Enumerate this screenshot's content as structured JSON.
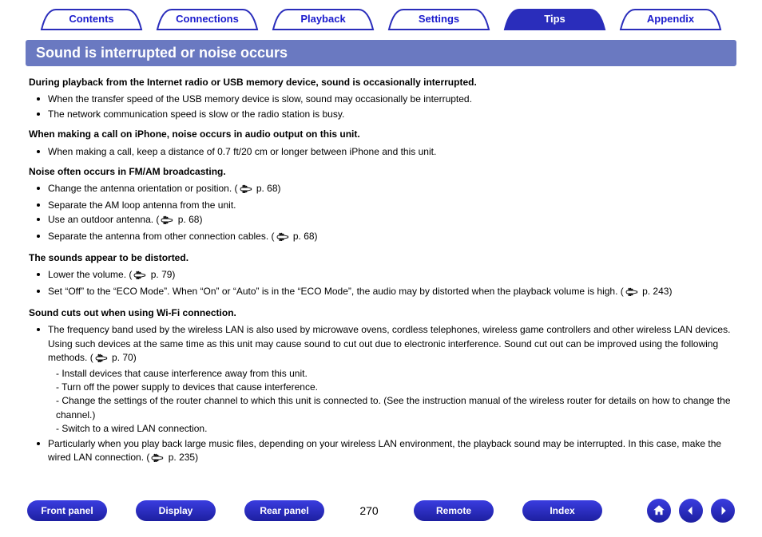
{
  "tabs": [
    {
      "label": "Contents",
      "active": false
    },
    {
      "label": "Connections",
      "active": false
    },
    {
      "label": "Playback",
      "active": false
    },
    {
      "label": "Settings",
      "active": false
    },
    {
      "label": "Tips",
      "active": true
    },
    {
      "label": "Appendix",
      "active": false
    }
  ],
  "title": "Sound is interrupted or noise occurs",
  "sections": [
    {
      "heading": "During playback from the Internet radio or USB memory device, sound is occasionally interrupted.",
      "items": [
        {
          "text": "When the transfer speed of the USB memory device is slow, sound may occasionally be interrupted."
        },
        {
          "text": "The network communication speed is slow or the radio station is busy."
        }
      ]
    },
    {
      "heading": "When making a call on iPhone, noise occurs in audio output on this unit.",
      "items": [
        {
          "text": "When making a call, keep a distance of 0.7 ft/20 cm or longer between iPhone and this unit."
        }
      ]
    },
    {
      "heading": "Noise often occurs in FM/AM broadcasting.",
      "items": [
        {
          "text": "Change the antenna orientation or position.  (",
          "ref": " p. 68)",
          "hasRef": true
        },
        {
          "text": "Separate the AM loop antenna from the unit."
        },
        {
          "text": "Use an outdoor antenna.  (",
          "ref": " p. 68)",
          "hasRef": true
        },
        {
          "text": "Separate the antenna from other connection cables.  (",
          "ref": " p. 68)",
          "hasRef": true
        }
      ]
    },
    {
      "heading": "The sounds appear to be distorted.",
      "items": [
        {
          "text": "Lower the volume.  (",
          "ref": " p. 79)",
          "hasRef": true
        },
        {
          "text": "Set “Off” to the “ECO Mode”. When “On” or “Auto” is in the “ECO Mode”, the audio may by distorted when the playback volume is high.  (",
          "ref": " p. 243)",
          "hasRef": true
        }
      ]
    },
    {
      "heading": "Sound cuts out when using Wi-Fi connection.",
      "items": [
        {
          "text": "The frequency band used by the wireless LAN is also used by microwave ovens, cordless telephones, wireless game controllers and other wireless LAN devices. Using such devices at the same time as this unit may cause sound to cut out due to electronic interference. Sound cut out can be improved using the following methods.  (",
          "ref": " p. 70)",
          "hasRef": true,
          "subs": [
            "- Install devices that cause interference away from this unit.",
            "- Turn off the power supply to devices that cause interference.",
            "- Change the settings of the router channel to which this unit is connected to. (See the instruction manual of the wireless router for details on how to change the channel.)",
            "- Switch to a wired LAN connection."
          ]
        },
        {
          "text": "Particularly when you play back large music files, depending on your wireless LAN environment, the playback sound may be interrupted. In this case, make the wired LAN connection.  (",
          "ref": " p. 235)",
          "hasRef": true
        }
      ]
    }
  ],
  "bottom": {
    "buttons": [
      "Front panel",
      "Display",
      "Rear panel",
      "Remote",
      "Index"
    ],
    "page": "270"
  }
}
